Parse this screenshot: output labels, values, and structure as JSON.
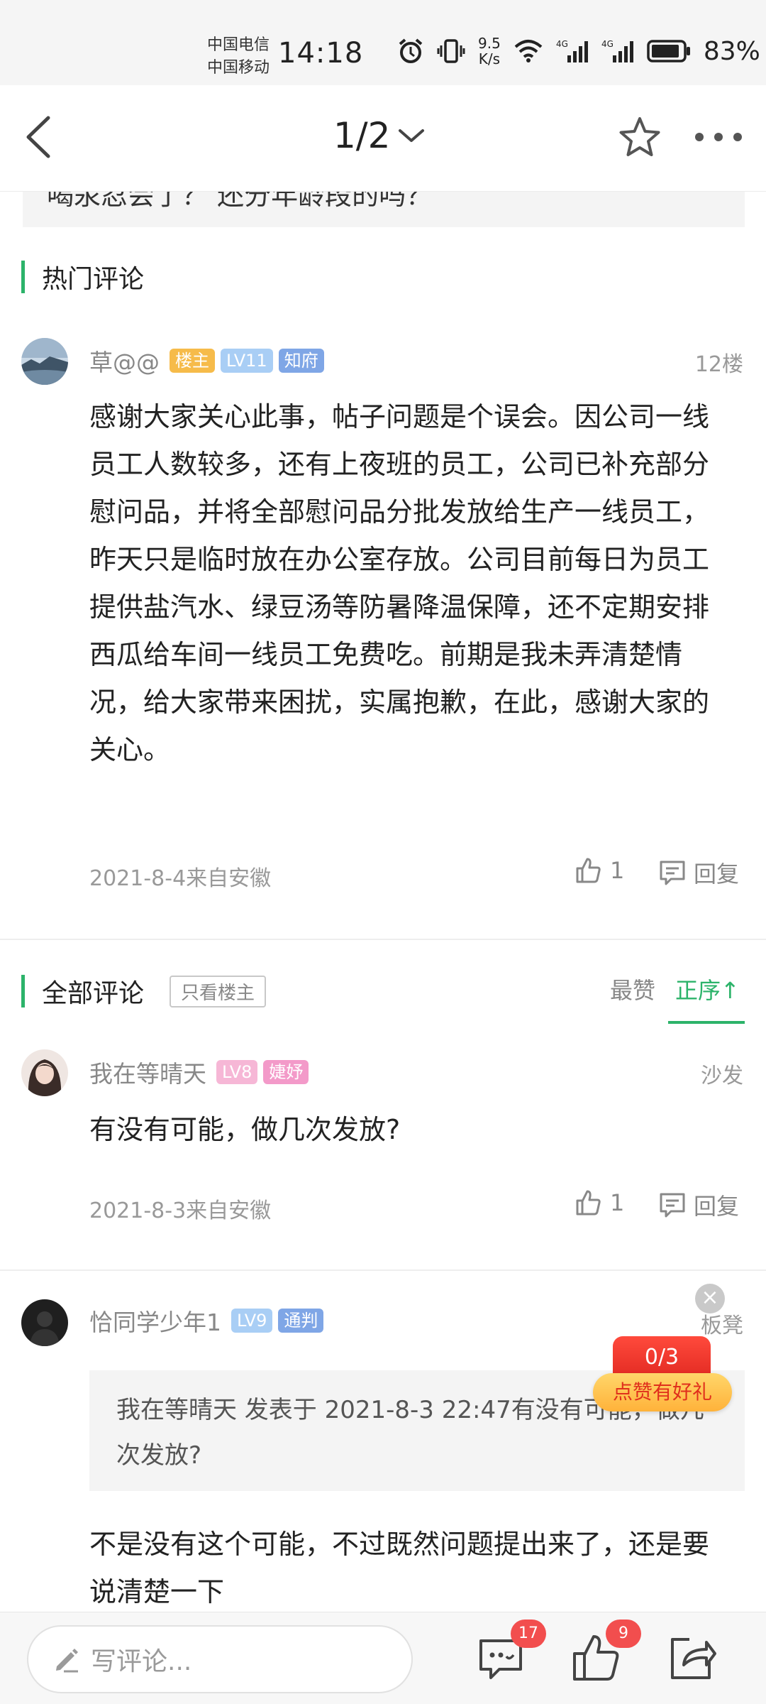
{
  "status_bar": {
    "carrier1": "中国电信",
    "carrier2": "中国移动",
    "time": "14:18",
    "speed_value": "9.5",
    "speed_unit": "K/s",
    "network1": "4G",
    "network2": "4G",
    "battery": "83%"
  },
  "nav": {
    "page_indicator": "1/2"
  },
  "quote_strip_text": "喝汞忍会了？ 还分年龄段的吗？",
  "hot_section": {
    "title": "热门评论",
    "comment": {
      "username": "草@@",
      "tags": [
        "楼主",
        "LV11",
        "知府"
      ],
      "floor": "12楼",
      "text": "感谢大家关心此事，帖子问题是个误会。因公司一线员工人数较多，还有上夜班的员工，公司已补充部分慰问品，并将全部慰问品分批发放给生产一线员工，昨天只是临时放在办公室存放。公司目前每日为员工提供盐汽水、绿豆汤等防暑降温保障，还不定期安排西瓜给车间一线员工免费吃。前期是我未弄清楚情况，给大家带来困扰，实属抱歉，在此，感谢大家的关心。",
      "date": "2021-8-4来自安徽",
      "likes": "1",
      "reply_label": "回复"
    }
  },
  "all_section": {
    "title": "全部评论",
    "only_owner_label": "只看楼主",
    "sort_hot": "最赞",
    "sort_order": "正序↑",
    "comments": [
      {
        "username": "我在等晴天",
        "tags": [
          "LV8",
          "婕妤"
        ],
        "floor": "沙发",
        "text": "有没有可能，做几次发放?",
        "date": "2021-8-3来自安徽",
        "likes": "1",
        "reply_label": "回复"
      },
      {
        "username": "恰同学少年1",
        "tags": [
          "LV9",
          "通判"
        ],
        "floor": "板凳",
        "quote": "我在等晴天 发表于 2021-8-3 22:47有没有可能，做几次发放?",
        "text": "不是没有这个可能，不过既然问题提出来了，还是要说清楚一下"
      }
    ]
  },
  "promo": {
    "count": "0/3",
    "label": "点赞有好礼",
    "close": "×"
  },
  "bottom_bar": {
    "input_placeholder": "写评论...",
    "comment_count": "17",
    "like_count": "9"
  },
  "colors": {
    "accent": "#2cb36a",
    "badge": "#f24e4e"
  }
}
